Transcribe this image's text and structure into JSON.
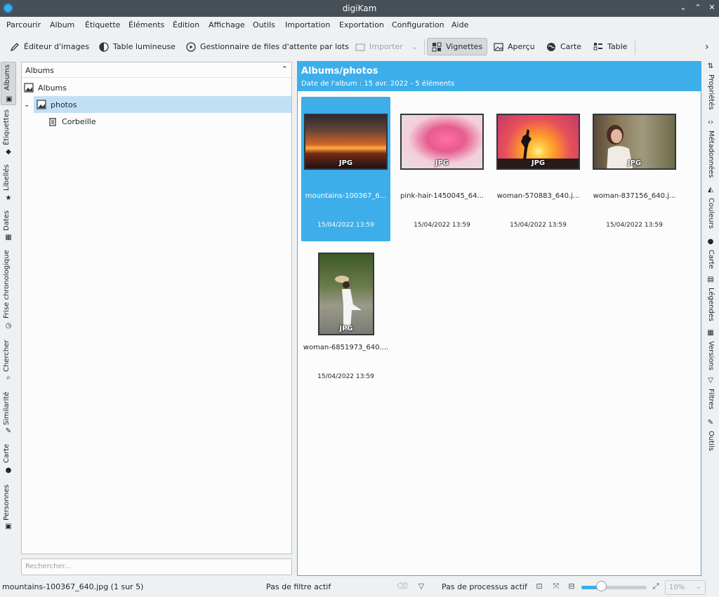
{
  "window": {
    "title": "digiKam"
  },
  "menubar": [
    "Parcourir",
    "Album",
    "Étiquette",
    "Éléments",
    "Édition",
    "Affichage",
    "Outils",
    "Importation",
    "Exportation",
    "Configuration",
    "Aide"
  ],
  "toolbar": {
    "image_editor": "Éditeur d'images",
    "light_table": "Table lumineuse",
    "batch_queue": "Gestionnaire de files d'attente par lots",
    "import": "Importer",
    "thumbnails": "Vignettes",
    "preview": "Aperçu",
    "map": "Carte",
    "table": "Table"
  },
  "left_tabs": [
    "Albums",
    "Étiquettes",
    "Libellés",
    "Dates",
    "Frise chronologique",
    "Chercher",
    "Similarité",
    "Carte",
    "Personnes"
  ],
  "right_tabs": [
    "Propriétés",
    "Métadonnées",
    "Couleurs",
    "Carte",
    "Légendes",
    "Versions",
    "Filtres",
    "Outils"
  ],
  "albums_panel": {
    "header": "Albums",
    "tree": [
      {
        "label": "Albums",
        "icon": "album-icon"
      },
      {
        "label": "photos",
        "icon": "album-icon"
      },
      {
        "label": "Corbeille",
        "icon": "trash-icon"
      }
    ],
    "search_placeholder": "Rechercher..."
  },
  "content": {
    "title": "Albums/photos",
    "subtitle": "Date de l'album : 15 avr. 2022 - 5 éléments",
    "items": [
      {
        "name": "mountains-100367_6...",
        "date": "15/04/2022 13:59",
        "format": "JPG"
      },
      {
        "name": "pink-hair-1450045_64...",
        "date": "15/04/2022 13:59",
        "format": "JPG"
      },
      {
        "name": "woman-570883_640.j...",
        "date": "15/04/2022 13:59",
        "format": "JPG"
      },
      {
        "name": "woman-837156_640.j...",
        "date": "15/04/2022 13:59",
        "format": "JPG"
      },
      {
        "name": "woman-6851973_640....",
        "date": "15/04/2022 13:59",
        "format": "JPG"
      }
    ]
  },
  "statusbar": {
    "selection": "mountains-100367_640.jpg (1 sur 5)",
    "filter": "Pas de filtre actif",
    "process": "Pas de processus actif",
    "zoom": "10%",
    "zoom_slider_fraction": 0.3
  },
  "colors": {
    "accent": "#3daee9",
    "titlebar": "#475057",
    "background": "#eff0f1"
  }
}
